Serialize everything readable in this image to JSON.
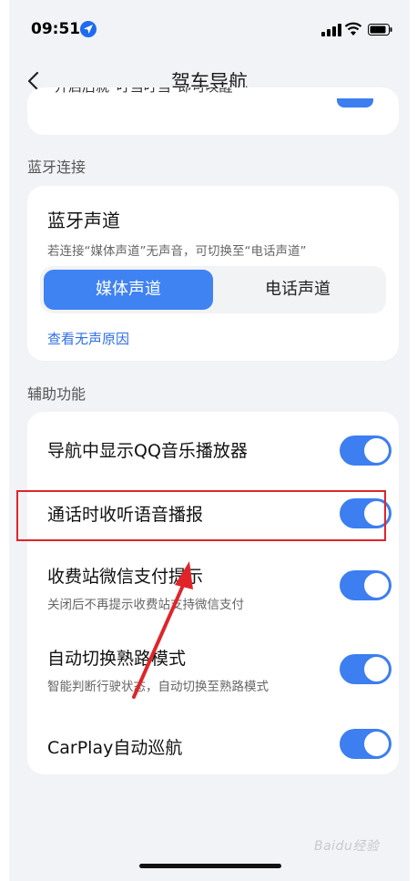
{
  "status_bar": {
    "time": "09:51",
    "location_icon": "location-arrow-icon",
    "signal_icon": "cellular-signal-icon",
    "wifi_icon": "wifi-icon",
    "battery_icon": "battery-icon"
  },
  "nav": {
    "title": "驾车导航",
    "back_icon": "chevron-left-icon"
  },
  "cut_top_card": {
    "partial_text": "开启后就“叮当叮当”即可唤醒"
  },
  "bluetooth_section": {
    "header": "蓝牙连接",
    "title": "蓝牙声道",
    "subtitle": "若连接“媒体声道”无声音，可切换至“电话声道”",
    "options": [
      "媒体声道",
      "电话声道"
    ],
    "selected": "媒体声道",
    "link": "查看无声原因"
  },
  "aux_section": {
    "header": "辅助功能",
    "items": [
      {
        "label": "导航中显示QQ音乐播放器",
        "subtitle": "",
        "enabled": true
      },
      {
        "label": "通话时收听语音播报",
        "subtitle": "",
        "enabled": true
      },
      {
        "label": "收费站微信支付提示",
        "subtitle": "关闭后不再提示收费站支持微信支付",
        "enabled": true
      },
      {
        "label": "自动切换熟路模式",
        "subtitle": "智能判断行驶状态，自动切换至熟路模式",
        "enabled": true
      },
      {
        "label": "CarPlay自动巡航",
        "subtitle": "",
        "enabled": true
      }
    ]
  },
  "annotation": {
    "highlight_color": "#e0242a",
    "arrow_color": "#e0242a"
  },
  "watermark": "Baidu经验",
  "colors": {
    "accent": "#3d7ef0",
    "link": "#2f6fe8",
    "background": "#f2f3f6"
  }
}
